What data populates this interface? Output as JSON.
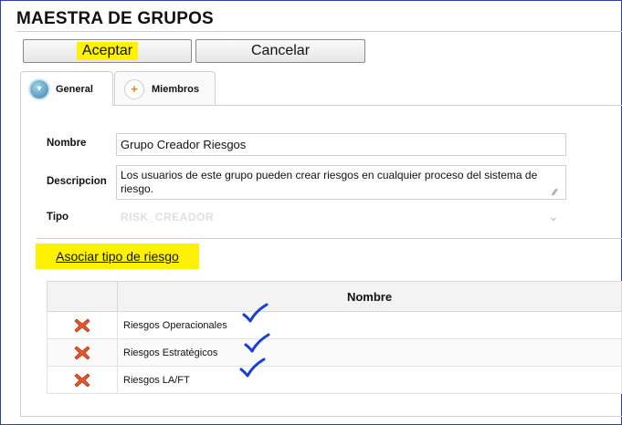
{
  "page": {
    "title": "MAESTRA DE GRUPOS"
  },
  "toolbar": {
    "accept_label": "Aceptar",
    "cancel_label": "Cancelar"
  },
  "tabs": [
    {
      "label": "General",
      "icon": "chevron-down-icon",
      "active": true
    },
    {
      "label": "Miembros",
      "icon": "plus-icon",
      "active": false
    }
  ],
  "form": {
    "nombre_label": "Nombre",
    "nombre_value": "Grupo Creador Riesgos",
    "descripcion_label": "Descripcion",
    "descripcion_value": "Los usuarios de este grupo pueden crear riesgos en cualquier proceso del sistema de riesgo.",
    "tipo_label": "Tipo",
    "tipo_value": "RISK_CREADOR"
  },
  "link": {
    "associate_label": "Asociar tipo de riesgo"
  },
  "table": {
    "columns": [
      "",
      "Nombre"
    ],
    "rows": [
      {
        "nombre": "Riesgos Operacionales"
      },
      {
        "nombre": "Riesgos Estratégicos"
      },
      {
        "nombre": "Riesgos LA/FT"
      }
    ]
  },
  "colors": {
    "highlight": "#fff200",
    "annotation_check": "#1a3fd6",
    "delete_icon": "#e8572a",
    "frame_border": "#2d3fb0"
  }
}
